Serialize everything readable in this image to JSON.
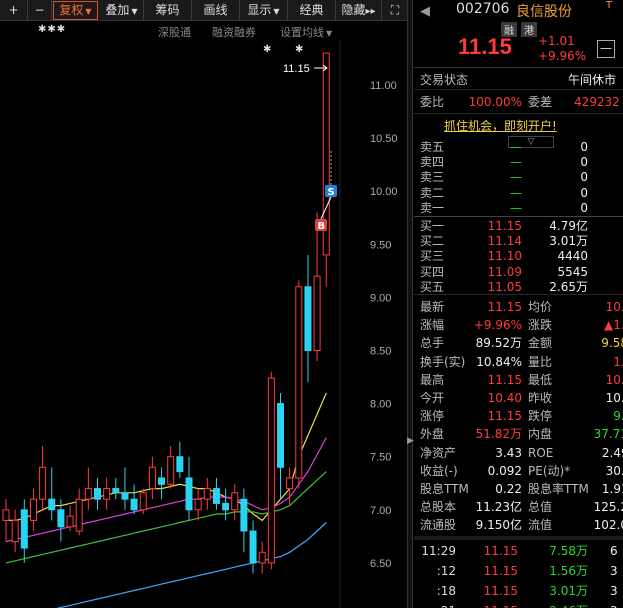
{
  "toolbar": {
    "plus": "+",
    "minus": "−",
    "fuquan": "复权",
    "diejia": "叠加",
    "chouma": "筹码",
    "huaxian": "画线",
    "xianshi": "显示",
    "jingdian": "经典",
    "yincang": "隐藏",
    "fastforward": "▸▸",
    "fullscreen": "⛶"
  },
  "subbar": {
    "stars_left": "✱✱✱",
    "shengutong": "深股通",
    "rongzirongquan": "融资融券",
    "star_right": "✱",
    "shezhi": "设置均线",
    "star_top": "✱"
  },
  "chart_axis": {
    "high_label": "11.15",
    "y_ticks": [
      "11.00",
      "10.50",
      "10.00",
      "9.50",
      "9.00",
      "8.50",
      "8.00",
      "7.50",
      "7.00",
      "6.50"
    ],
    "b_marker": "B",
    "s_marker": "S"
  },
  "chart_data": {
    "type": "candlestick",
    "ylim": [
      6.25,
      11.45
    ],
    "candles": [
      {
        "o": 8.95,
        "h": 9.05,
        "l": 8.85,
        "c": 9.0
      },
      {
        "o": 8.85,
        "h": 9.0,
        "l": 8.8,
        "c": 8.95
      },
      {
        "o": 9.0,
        "h": 9.05,
        "l": 8.75,
        "c": 8.82
      },
      {
        "o": 8.95,
        "h": 9.1,
        "l": 8.9,
        "c": 9.05
      },
      {
        "o": 9.05,
        "h": 9.3,
        "l": 9.0,
        "c": 9.2
      },
      {
        "o": 9.05,
        "h": 9.2,
        "l": 8.95,
        "c": 9.0
      },
      {
        "o": 9.0,
        "h": 9.05,
        "l": 8.85,
        "c": 8.92
      },
      {
        "o": 8.92,
        "h": 9.02,
        "l": 8.9,
        "c": 8.97
      },
      {
        "o": 8.9,
        "h": 9.1,
        "l": 8.88,
        "c": 9.05
      },
      {
        "o": 9.05,
        "h": 9.2,
        "l": 9.0,
        "c": 9.1
      },
      {
        "o": 9.1,
        "h": 9.15,
        "l": 9.0,
        "c": 9.05
      },
      {
        "o": 9.05,
        "h": 9.15,
        "l": 9.0,
        "c": 9.1
      },
      {
        "o": 9.1,
        "h": 9.15,
        "l": 9.05,
        "c": 9.08
      },
      {
        "o": 9.08,
        "h": 9.2,
        "l": 9.0,
        "c": 9.05
      },
      {
        "o": 9.05,
        "h": 9.12,
        "l": 8.98,
        "c": 9.0
      },
      {
        "o": 9.0,
        "h": 9.1,
        "l": 8.98,
        "c": 9.08
      },
      {
        "o": 9.1,
        "h": 9.25,
        "l": 9.05,
        "c": 9.2
      },
      {
        "o": 9.15,
        "h": 9.2,
        "l": 9.05,
        "c": 9.12
      },
      {
        "o": 9.12,
        "h": 9.3,
        "l": 9.1,
        "c": 9.25
      },
      {
        "o": 9.25,
        "h": 9.32,
        "l": 9.15,
        "c": 9.18
      },
      {
        "o": 9.15,
        "h": 9.25,
        "l": 8.95,
        "c": 9.0
      },
      {
        "o": 9.0,
        "h": 9.1,
        "l": 8.95,
        "c": 9.05
      },
      {
        "o": 9.05,
        "h": 9.15,
        "l": 9.0,
        "c": 9.1
      },
      {
        "o": 9.1,
        "h": 9.15,
        "l": 9.0,
        "c": 9.03
      },
      {
        "o": 9.03,
        "h": 9.1,
        "l": 8.95,
        "c": 9.0
      },
      {
        "o": 9.0,
        "h": 9.12,
        "l": 8.95,
        "c": 9.08
      },
      {
        "o": 9.05,
        "h": 9.1,
        "l": 8.8,
        "c": 8.9
      },
      {
        "o": 8.9,
        "h": 8.95,
        "l": 8.7,
        "c": 8.75
      },
      {
        "o": 8.75,
        "h": 8.85,
        "l": 8.7,
        "c": 8.8
      },
      {
        "o": 8.75,
        "h": 9.65,
        "l": 8.72,
        "c": 9.62
      },
      {
        "o": 9.5,
        "h": 9.55,
        "l": 9.05,
        "c": 9.2
      },
      {
        "o": 9.1,
        "h": 9.2,
        "l": 9.02,
        "c": 9.15
      },
      {
        "o": 9.15,
        "h": 10.08,
        "l": 9.1,
        "c": 10.05
      },
      {
        "o": 10.05,
        "h": 10.2,
        "l": 9.6,
        "c": 9.75
      },
      {
        "o": 9.75,
        "h": 10.4,
        "l": 9.7,
        "c": 10.1
      },
      {
        "o": 10.2,
        "h": 11.15,
        "l": 10.05,
        "c": 11.15
      }
    ],
    "ma": [
      {
        "color": "#f0e040",
        "values": [
          8.95,
          8.95,
          8.96,
          8.98,
          9.0,
          9.02,
          9.02,
          9.03,
          9.04,
          9.05,
          9.06,
          9.07,
          9.08,
          9.08,
          9.08,
          9.09,
          9.1,
          9.1,
          9.11,
          9.12,
          9.11,
          9.1,
          9.1,
          9.08,
          9.06,
          9.05,
          9.02,
          8.98,
          8.95,
          9.0,
          9.05,
          9.1,
          9.25,
          9.35,
          9.45,
          9.55
        ]
      },
      {
        "color": "#e040e0",
        "values": [
          8.85,
          8.86,
          8.87,
          8.88,
          8.89,
          8.9,
          8.91,
          8.92,
          8.93,
          8.94,
          8.95,
          8.96,
          8.97,
          8.98,
          8.99,
          9.0,
          9.01,
          9.02,
          9.03,
          9.04,
          9.05,
          9.05,
          9.06,
          9.06,
          9.06,
          9.05,
          9.04,
          9.02,
          9.0,
          9.01,
          9.03,
          9.06,
          9.12,
          9.18,
          9.26,
          9.34
        ]
      },
      {
        "color": "#40c040",
        "values": [
          8.75,
          8.76,
          8.77,
          8.78,
          8.79,
          8.8,
          8.81,
          8.82,
          8.83,
          8.84,
          8.85,
          8.86,
          8.87,
          8.88,
          8.89,
          8.9,
          8.91,
          8.92,
          8.93,
          8.94,
          8.95,
          8.96,
          8.97,
          8.98,
          8.98,
          8.99,
          8.99,
          8.99,
          8.98,
          8.99,
          9.0,
          9.02,
          9.06,
          9.1,
          9.14,
          9.18
        ]
      },
      {
        "color": "#3fa8ff",
        "values": [
          8.5,
          8.51,
          8.51,
          8.52,
          8.53,
          8.53,
          8.54,
          8.55,
          8.56,
          8.57,
          8.58,
          8.59,
          8.6,
          8.61,
          8.62,
          8.63,
          8.64,
          8.65,
          8.66,
          8.67,
          8.68,
          8.69,
          8.7,
          8.71,
          8.72,
          8.73,
          8.74,
          8.75,
          8.76,
          8.77,
          8.78,
          8.8,
          8.83,
          8.86,
          8.9,
          8.94
        ]
      }
    ]
  },
  "quote": {
    "nav_arrow": "◀",
    "code": "002706",
    "name": "良信股份",
    "tag_rong": "融",
    "tag_gang": "港",
    "tag_t": "T",
    "price": "11.15",
    "chg_abs": "+1.01",
    "chg_pct": "+9.96%",
    "minimize": "—",
    "status_label": "交易状态",
    "status_value": "午间休市",
    "weibi_label": "委比",
    "weibi_value": "100.00%",
    "weicha_label": "委差",
    "weicha_value": "429232",
    "promo": "抓住机会，即刻开户!",
    "expand": "▽"
  },
  "sells": [
    {
      "label": "卖五",
      "price": "—",
      "vol": "0"
    },
    {
      "label": "卖四",
      "price": "—",
      "vol": "0"
    },
    {
      "label": "卖三",
      "price": "—",
      "vol": "0"
    },
    {
      "label": "卖二",
      "price": "—",
      "vol": "0"
    },
    {
      "label": "卖一",
      "price": "—",
      "vol": "0"
    }
  ],
  "buys": [
    {
      "label": "买一",
      "price": "11.15",
      "vol": "4.79亿"
    },
    {
      "label": "买二",
      "price": "11.14",
      "vol": "3.01万"
    },
    {
      "label": "买三",
      "price": "11.10",
      "vol": "4440"
    },
    {
      "label": "买四",
      "price": "11.09",
      "vol": "5545"
    },
    {
      "label": "买五",
      "price": "11.05",
      "vol": "2.65万"
    }
  ],
  "stats": [
    {
      "l1": "最新",
      "v1": "11.15",
      "c1": "red",
      "l2": "均价",
      "v2": "10.71",
      "c2": "red"
    },
    {
      "l1": "涨幅",
      "v1": "+9.96%",
      "c1": "red",
      "l2": "涨跌",
      "v2": "▲1.01",
      "c2": "red"
    },
    {
      "l1": "总手",
      "v1": "89.52万",
      "c1": "white",
      "l2": "金额",
      "v2": "9.58亿",
      "c2": "yellow"
    },
    {
      "l1": "换手(实)",
      "v1": "10.84%",
      "c1": "white",
      "l2": "量比",
      "v2": "1.78",
      "c2": "red"
    },
    {
      "l1": "最高",
      "v1": "11.15",
      "c1": "red",
      "l2": "最低",
      "v2": "10.27",
      "c2": "red"
    },
    {
      "l1": "今开",
      "v1": "10.40",
      "c1": "red",
      "l2": "昨收",
      "v2": "10.14",
      "c2": "white"
    },
    {
      "l1": "涨停",
      "v1": "11.15",
      "c1": "red",
      "l2": "跌停",
      "v2": "9.13",
      "c2": "green"
    },
    {
      "l1": "外盘",
      "v1": "51.82万",
      "c1": "red",
      "l2": "内盘",
      "v2": "37.71万",
      "c2": "green"
    },
    {
      "l1": "净资产",
      "v1": "3.43",
      "c1": "white",
      "l2": "ROE",
      "v2": "2.49%",
      "c2": "white"
    },
    {
      "l1": "收益(-)",
      "v1": "0.092",
      "c1": "white",
      "l2": "PE(动)*",
      "v2": "30.35",
      "c2": "white"
    },
    {
      "l1": "股息TTM",
      "v1": "0.22",
      "c1": "white",
      "l2": "股息率TTM",
      "v2": "1.91%",
      "c2": "white"
    },
    {
      "l1": "总股本",
      "v1": "11.23亿",
      "c1": "white",
      "l2": "总值",
      "v2": "125.2亿",
      "c2": "white"
    },
    {
      "l1": "流通股",
      "v1": "9.150亿",
      "c1": "white",
      "l2": "流值",
      "v2": "102.0亿",
      "c2": "white"
    }
  ],
  "ticks": [
    {
      "t": "11:29",
      "p": "11.15",
      "v": "7.58万",
      "n": "6"
    },
    {
      "t": ":12",
      "p": "11.15",
      "v": "1.56万",
      "n": "3"
    },
    {
      "t": ":18",
      "p": "11.15",
      "v": "3.01万",
      "n": "3"
    },
    {
      "t": ":21",
      "p": "11.15",
      "v": "2.46万",
      "n": "3"
    }
  ],
  "colors": {
    "up": "#ff3b3b",
    "down": "#2bd82b",
    "accent": "#ff6a33"
  }
}
